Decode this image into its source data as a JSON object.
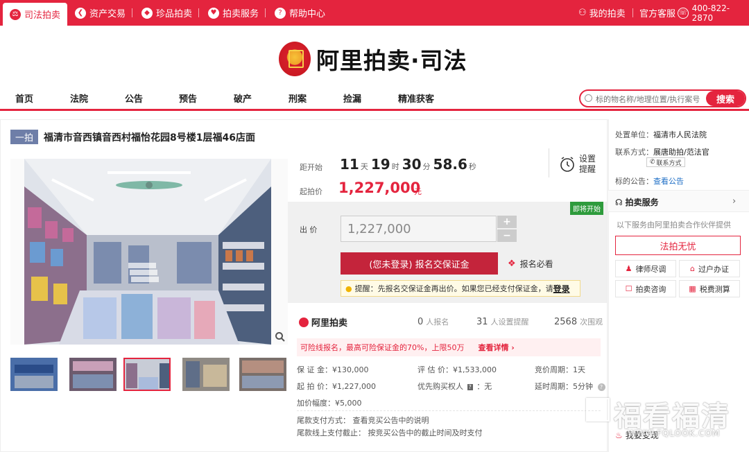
{
  "topbar": {
    "tabs": [
      {
        "label": "司法拍卖",
        "icon": "gavel-icon"
      },
      {
        "label": "资产交易",
        "icon": "asset-icon"
      },
      {
        "label": "珍品拍卖",
        "icon": "treasure-icon"
      },
      {
        "label": "拍卖服务",
        "icon": "heart-icon"
      },
      {
        "label": "帮助中心",
        "icon": "help-icon"
      }
    ],
    "my_auction": "我的拍卖",
    "customer_service": "官方客服",
    "phone": "400-822-2870"
  },
  "logo": {
    "text": "阿里拍卖·司法"
  },
  "nav": {
    "items": [
      "首页",
      "法院",
      "公告",
      "预告",
      "破产",
      "刑案",
      "捡漏",
      "精准获客"
    ],
    "search_placeholder": "标的物名称/地理位置/执行案号",
    "search_button": "搜索"
  },
  "item": {
    "round_badge": "一拍",
    "title": "福清市音西镇音西村福怡花园8号楼1层福46店面"
  },
  "countdown": {
    "label": "距开始",
    "days": "11",
    "days_unit": "天",
    "hours": "19",
    "hours_unit": "时",
    "minutes": "30",
    "minutes_unit": "分",
    "seconds": "58.6",
    "seconds_unit": "秒"
  },
  "remind": {
    "label": "设置提醒"
  },
  "start_price": {
    "label": "起拍价",
    "value": "1,227,000",
    "unit": "元"
  },
  "bid": {
    "status_tag": "即将开始",
    "label": "出 价",
    "value": "1,227,000",
    "plus": "+",
    "minus": "−",
    "signup_button": "(您未登录) 报名交保证金",
    "must_read": "报名必看",
    "tip_prefix": "提醒：先报名交保证金再出价。如果您已经支付保证金，请",
    "tip_login": "登录"
  },
  "stats": {
    "brand": "阿里拍卖",
    "registered": "0",
    "registered_unit": "人报名",
    "reminders": "31",
    "reminders_unit": "人设置提醒",
    "views": "2568",
    "views_unit": "次围观"
  },
  "warn": {
    "text": "可险线报名，最高可险保证金的70%，上限50万",
    "more": "查看详情 ›"
  },
  "details": {
    "deposit": "保 证 金：¥130,000",
    "appraisal": "评 估 价：¥1,533,000",
    "bid_period": "竞价周期：1天",
    "start_price": "起 拍 价：¥1,227,000",
    "priority": "优先购买权人",
    "priority_value": "无",
    "delay": "延时周期：5分钟",
    "increment": "加价幅度：¥5,000",
    "payment_method": "尾款支付方式：   查看竞买公告中的说明",
    "payment_deadline": "尾款线上支付截止：   按竞买公告中的截止时间及时支付"
  },
  "right": {
    "court_label": "处置单位：",
    "court": "福清市人民法院",
    "contact_label": "联系方式：",
    "contact": "展唐助拍/范法官",
    "contact_tag": "联系方式",
    "notice_label": "标的公告：",
    "notice_link": "查看公告",
    "service_title": "拍卖服务",
    "service_desc": "以下服务由阿里拍卖合作伙伴提供",
    "fawu": "法拍无忧",
    "services": [
      "律师尽调",
      "过户办证",
      "拍卖咨询",
      "税费测算"
    ],
    "bottom": "我要变现"
  },
  "watermark": {
    "text": "福看福清",
    "url": "WWW.FQLOOK.COM"
  },
  "colors": {
    "brand_red": "#e4243e",
    "badge_blue": "#6e7ea8",
    "green": "#2e9b3c"
  }
}
